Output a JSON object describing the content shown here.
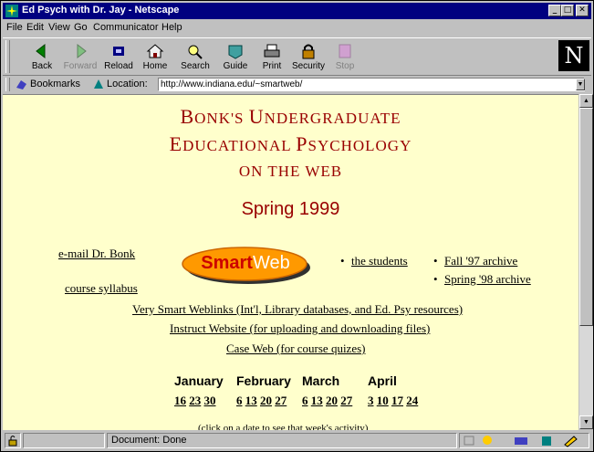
{
  "window": {
    "title": "Ed Psych with Dr. Jay - Netscape",
    "min_label": "_",
    "max_label": "□",
    "close_label": "✕"
  },
  "menu": [
    "File",
    "Edit",
    "View",
    "Go",
    "Communicator",
    "Help"
  ],
  "toolbar": {
    "buttons": [
      {
        "label": "Back",
        "icon": "back-arrow-icon",
        "enabled": true
      },
      {
        "label": "Forward",
        "icon": "forward-arrow-icon",
        "enabled": false
      },
      {
        "label": "Reload",
        "icon": "reload-icon",
        "enabled": true
      },
      {
        "label": "Home",
        "icon": "home-icon",
        "enabled": true
      },
      {
        "label": "Search",
        "icon": "search-icon",
        "enabled": true
      },
      {
        "label": "Guide",
        "icon": "guide-icon",
        "enabled": true
      },
      {
        "label": "Print",
        "icon": "print-icon",
        "enabled": true
      },
      {
        "label": "Security",
        "icon": "security-lock-icon",
        "enabled": true
      },
      {
        "label": "Stop",
        "icon": "stop-icon",
        "enabled": false
      }
    ],
    "logo_letter": "N"
  },
  "location": {
    "bookmarks_label": "Bookmarks",
    "location_label": "Location:",
    "url": "http://www.indiana.edu/~smartweb/"
  },
  "page": {
    "heading_line1_cap": "B",
    "heading_line1_rest": "ONK'S ",
    "heading_line1_cap2": "U",
    "heading_line1_rest2": "NDERGRADUATE",
    "heading_line2_cap": "E",
    "heading_line2_rest": "DUCATIONAL ",
    "heading_line2_cap2": "P",
    "heading_line2_rest2": "SYCHOLOGY",
    "heading_line3": "ON THE WEB",
    "semester": "Spring 1999",
    "logo_text_bold": "Smart",
    "logo_text_light": "Web",
    "left_links": {
      "email": "e-mail Dr. Bonk",
      "syllabus": "course syllabus"
    },
    "middle_links": {
      "students": "the students"
    },
    "right_links": {
      "fall": "Fall '97 archive",
      "spring": "Spring '98 archive"
    },
    "center_links": [
      "Very Smart Weblinks (Int'l, Library databases, and Ed. Psy resources)",
      "Instruct Website (for uploading and downloading files)",
      "Case Web (for course quizes)"
    ],
    "months": [
      "January",
      "February",
      "March",
      "April"
    ],
    "dates": {
      "january": [
        "16",
        "23",
        "30"
      ],
      "february": [
        "6",
        "13",
        "20",
        "27"
      ],
      "march": [
        "6",
        "13",
        "20",
        "27"
      ],
      "april": [
        "3",
        "10",
        "17",
        "24"
      ]
    },
    "click_note": "(click on a date to see that week's activity)"
  },
  "status": {
    "text": "Document: Done"
  },
  "colors": {
    "title_bg": "#000080",
    "page_bg": "#ffffcc",
    "heading": "#990000",
    "logo_fill": "#ff9900",
    "logo_text": "#cc0000"
  }
}
